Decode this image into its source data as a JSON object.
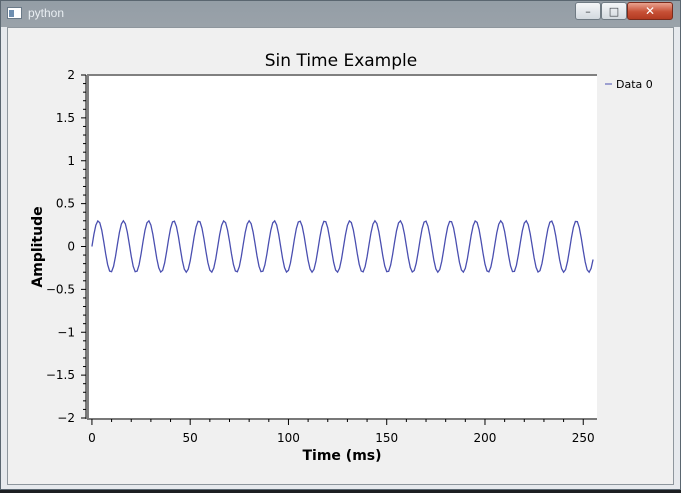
{
  "window": {
    "title": "python",
    "minimize_glyph": "–",
    "maximize_glyph": "□",
    "close_glyph": "✕"
  },
  "chart_data": {
    "type": "line",
    "title": "Sin Time Example",
    "xlabel": "Time (ms)",
    "ylabel": "Amplitude",
    "xlim": [
      -2,
      257
    ],
    "ylim": [
      -2,
      2
    ],
    "x_ticks": [
      0,
      50,
      100,
      150,
      200,
      250
    ],
    "x_tick_labels": [
      "0",
      "50",
      "100",
      "150",
      "200",
      "250"
    ],
    "y_ticks": [
      2,
      1.5,
      1,
      0.5,
      0,
      -0.5,
      -1,
      -1.5,
      -2
    ],
    "y_tick_labels": [
      "2",
      "1.5",
      "1",
      "0.5",
      "0",
      "−0.5",
      "−1",
      "−1.5",
      "−2"
    ],
    "grid": false,
    "legend_placement": "right",
    "series": [
      {
        "name": "Data 0",
        "color": "#4a4fb0",
        "function": "amplitude * sin(2 * pi * frequency * t)",
        "amplitude": 0.3,
        "frequency_per_ms": 0.0781,
        "x_start": 0,
        "x_end": 255,
        "samples": 256
      }
    ]
  }
}
